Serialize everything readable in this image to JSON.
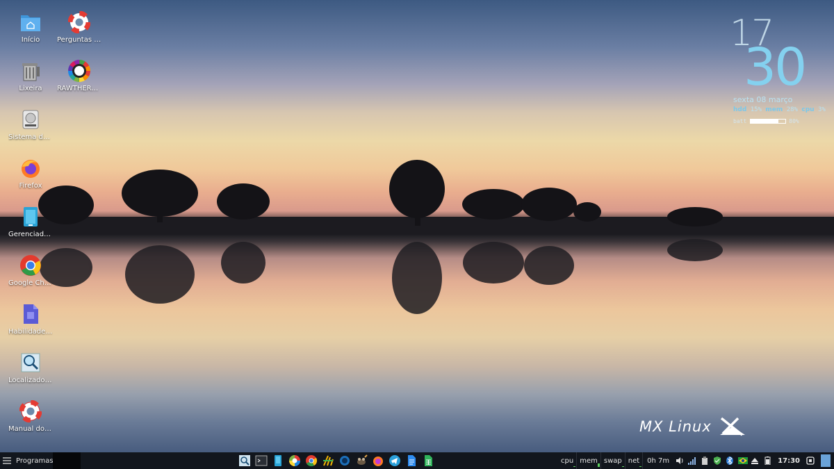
{
  "desktop": {
    "icons_col1": [
      {
        "label": "Início",
        "icon": "home-folder-icon"
      },
      {
        "label": "Lixeira",
        "icon": "trash-icon"
      },
      {
        "label": "Sistema de ...",
        "icon": "drive-icon"
      },
      {
        "label": "Firefox",
        "icon": "firefox-icon"
      },
      {
        "label": "Gerenciador...",
        "icon": "file-manager-icon"
      },
      {
        "label": "Google Chro...",
        "icon": "chrome-icon"
      },
      {
        "label": "Habilidades ...",
        "icon": "document-icon"
      },
      {
        "label": "Localizador ...",
        "icon": "search-icon"
      },
      {
        "label": "Manual do ...",
        "icon": "help-lifebuoy-icon"
      }
    ],
    "icons_col2": [
      {
        "label": "Perguntas F...",
        "icon": "help-lifebuoy-icon"
      },
      {
        "label": "RAWTHERAPY",
        "icon": "color-wheel-icon"
      }
    ]
  },
  "conky": {
    "hour": "17",
    "minute": "30",
    "date": "sexta  08 março",
    "hdd_label": "hdd",
    "hdd_value": "15%",
    "mem_label": "mem",
    "mem_value": "28%",
    "cpu_label": "cpu",
    "cpu_value": "3%",
    "batt_label": "batt",
    "batt_value": "80%",
    "batt_fraction": 0.8
  },
  "branding": {
    "logo_text": "MX Linux"
  },
  "taskbar": {
    "menu_label": "Programas",
    "launchers": [
      "catfish-search-icon",
      "terminal-icon",
      "file-manager-icon",
      "rawtherapee-icon",
      "chrome-icon",
      "hexchat-icon",
      "firefox-dark-icon",
      "gimp-icon",
      "firefox-icon",
      "telegram-icon",
      "document-icon",
      "spreadsheet-icon"
    ],
    "monitors": [
      {
        "label": "cpu",
        "level": 0.05
      },
      {
        "label": "mem",
        "level": 0.3
      },
      {
        "label": "swap",
        "level": 0.0
      },
      {
        "label": "net",
        "level": 0.05
      }
    ],
    "uptime": "0h 7m",
    "clock": "17:30",
    "tray_icons": [
      "volume-icon",
      "signal-icon",
      "clipboard-icon",
      "update-shield-icon",
      "bluetooth-icon",
      "brazil-flag-icon",
      "eject-icon",
      "battery-icon"
    ]
  },
  "colors": {
    "accent": "#84d1ef",
    "taskbar_bg": "#12161d"
  }
}
